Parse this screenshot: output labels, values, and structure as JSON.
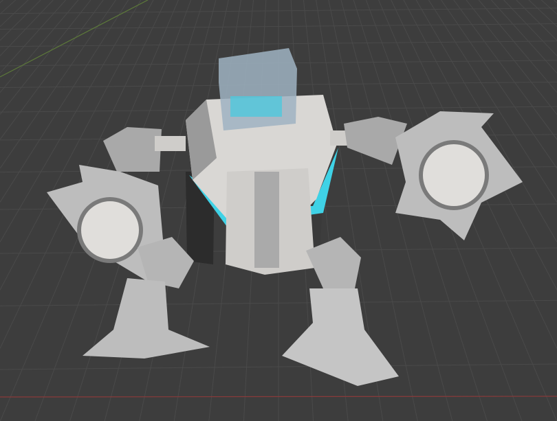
{
  "viewport": {
    "background": "#3d3d3d",
    "grid_color": "#4a4a4a",
    "x_axis_color": "#8a3a3a",
    "y_axis_color": "#5d7a3a"
  },
  "model": {
    "body_color": "#d9d7d4",
    "shade_color": "#8c8c8c",
    "dark_color": "#2c2c2c",
    "accent_color": "#3fd2e6",
    "head_color": "#9fb3c2"
  }
}
